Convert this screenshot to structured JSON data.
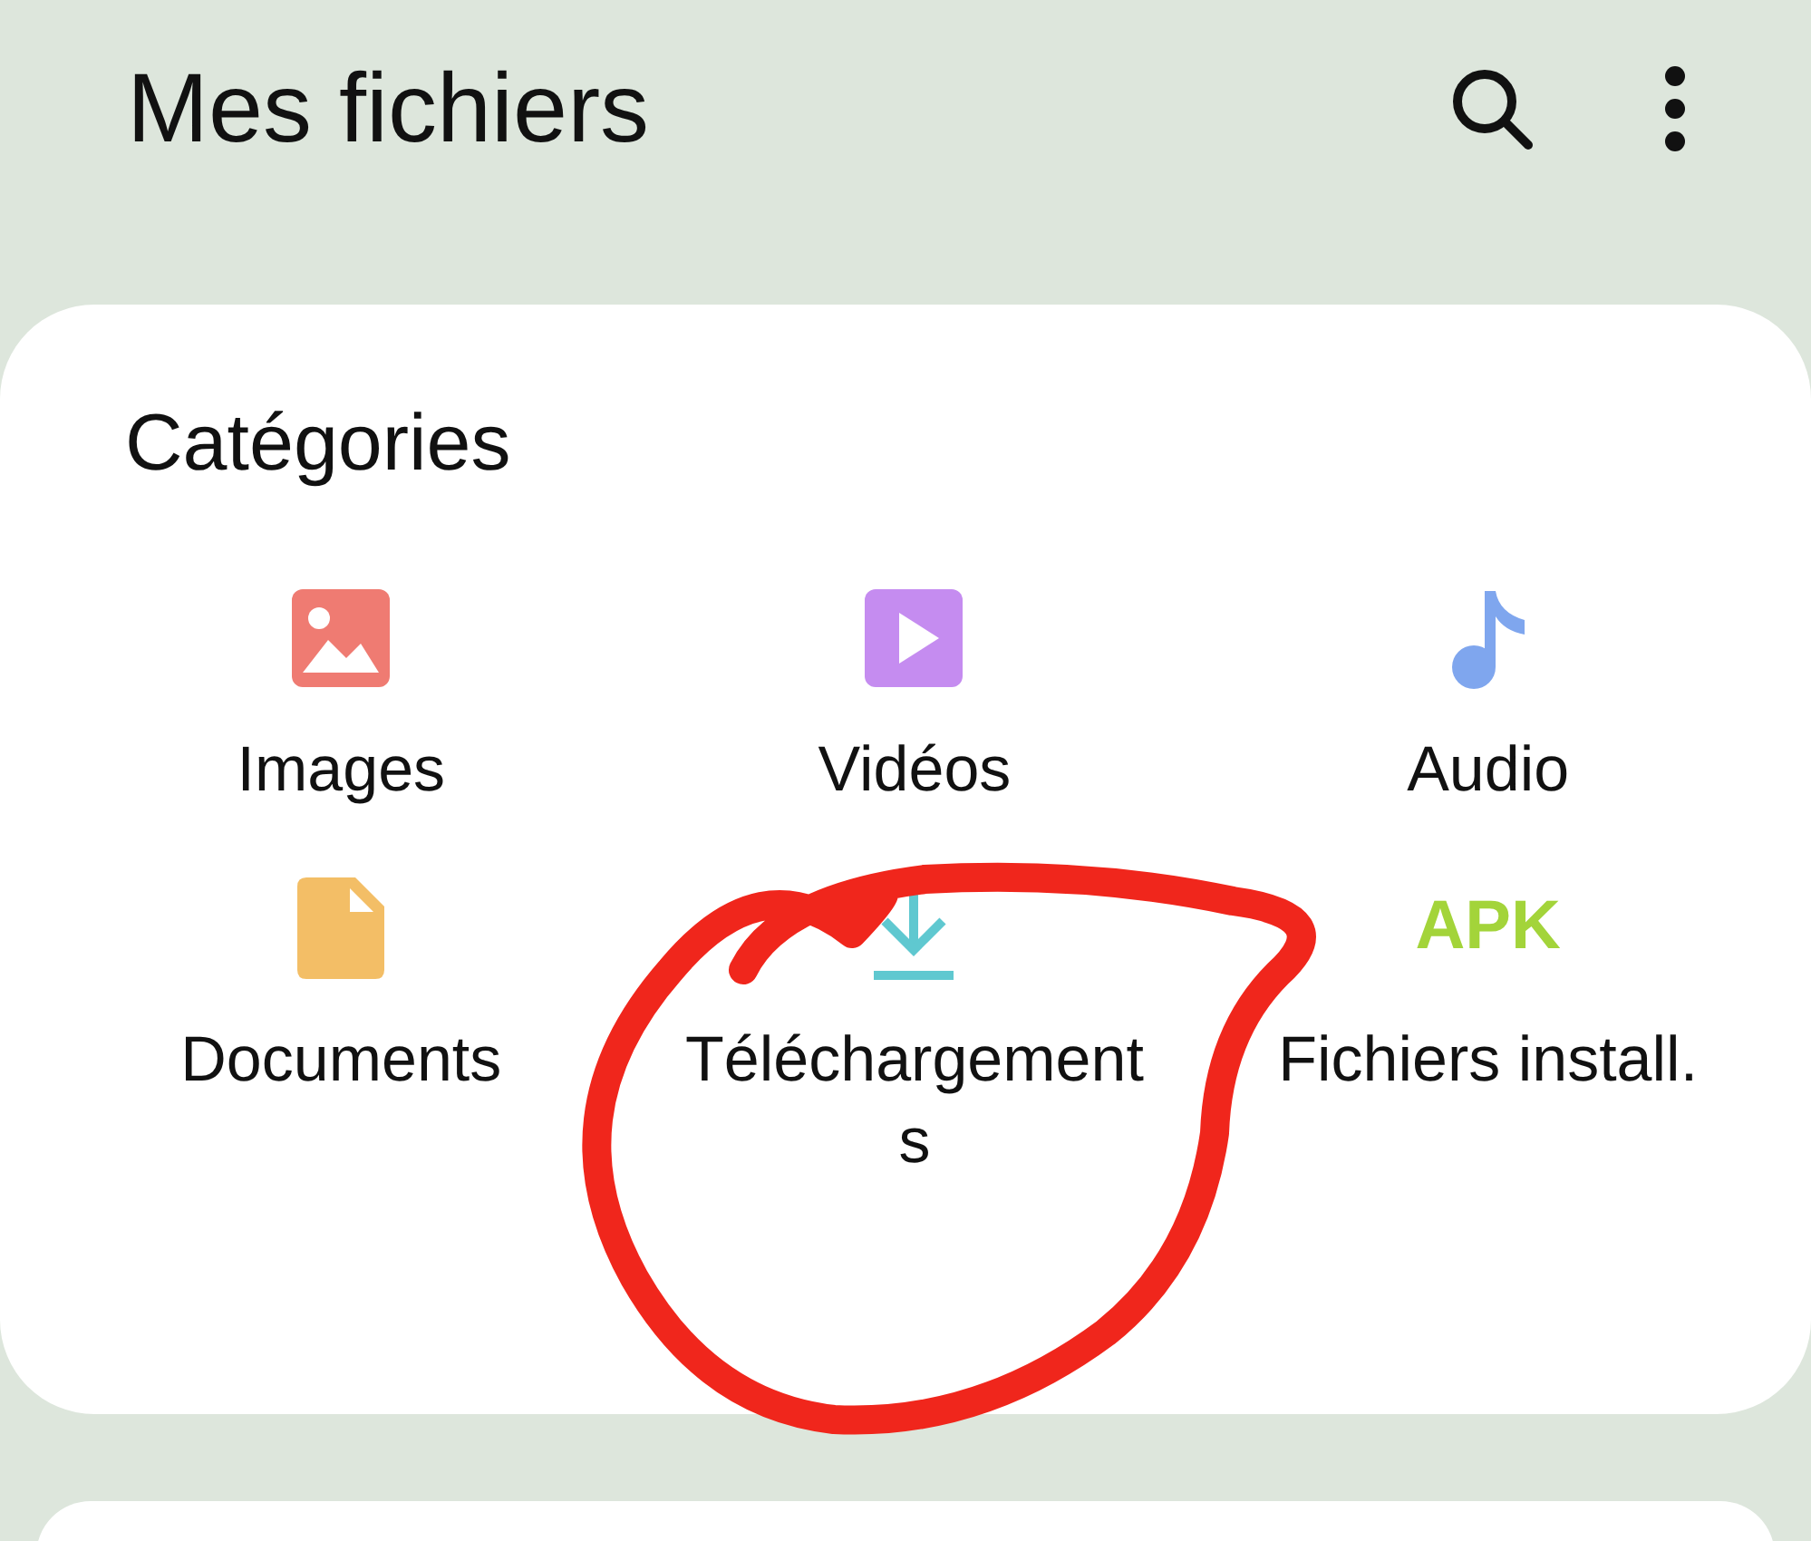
{
  "app_bar": {
    "title": "Mes fichiers"
  },
  "categories": {
    "title": "Catégories",
    "items": [
      {
        "kind": "image",
        "label": "Images",
        "color": "#ef7b72"
      },
      {
        "kind": "video",
        "label": "Vidéos",
        "color": "#c58cf0"
      },
      {
        "kind": "audio",
        "label": "Audio",
        "color": "#7fa6ee"
      },
      {
        "kind": "document",
        "label": "Documents",
        "color": "#f3be66"
      },
      {
        "kind": "download",
        "label": "Téléchargements",
        "color": "#5fc8d0"
      },
      {
        "kind": "apk",
        "label": "Fichiers install.",
        "color": "#a3d43a",
        "icon_text": "APK"
      }
    ]
  },
  "annotation": {
    "kind": "circle"
  }
}
